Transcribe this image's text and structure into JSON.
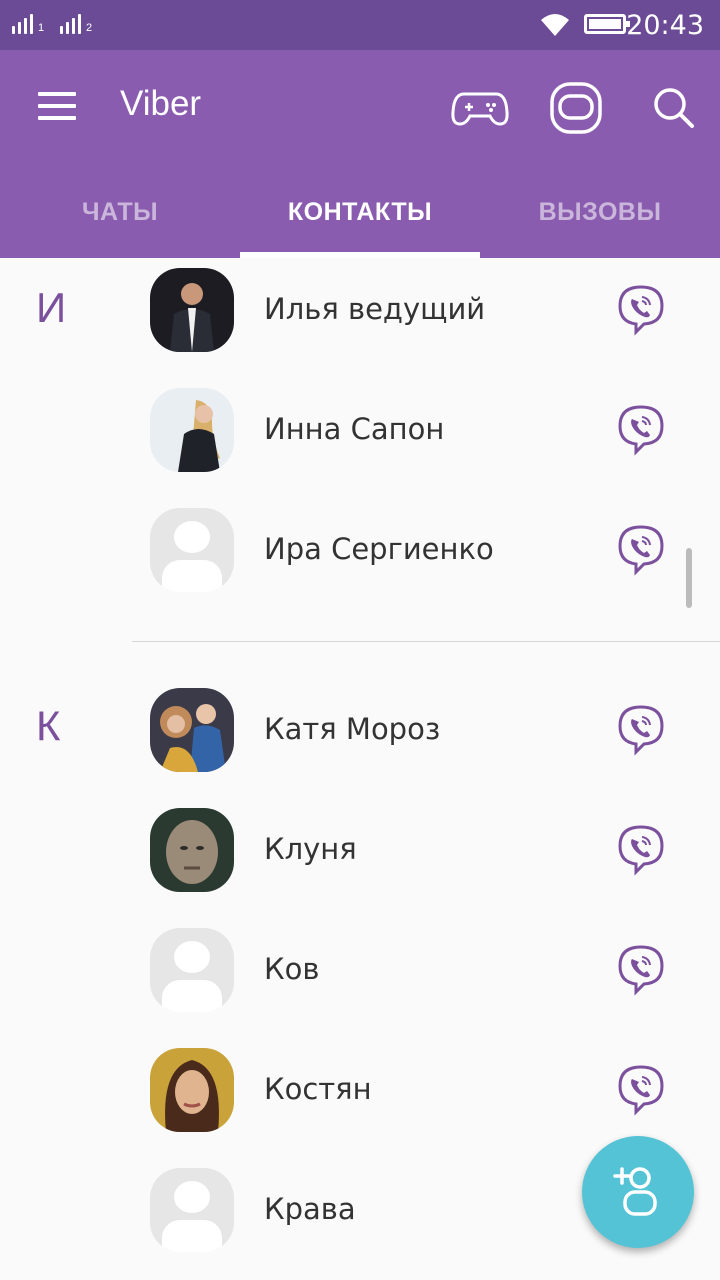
{
  "status_bar": {
    "sim1": "1",
    "sim2": "2",
    "time": "20:43"
  },
  "header": {
    "title": "Viber",
    "icons": [
      "menu-icon",
      "games-icon",
      "sticker-market-icon",
      "search-icon"
    ]
  },
  "tabs": [
    {
      "label": "ЧАТЫ",
      "active": false
    },
    {
      "label": "КОНТАКТЫ",
      "active": true
    },
    {
      "label": "ВЫЗОВЫ",
      "active": false
    }
  ],
  "sections": [
    {
      "letter": "И",
      "contacts": [
        {
          "name": "Илья ведущий",
          "avatar": "photo"
        },
        {
          "name": "Инна Сапон",
          "avatar": "photo"
        },
        {
          "name": "Ира Сергиенко",
          "avatar": "placeholder"
        }
      ]
    },
    {
      "letter": "К",
      "contacts": [
        {
          "name": "Катя Мороз",
          "avatar": "photo"
        },
        {
          "name": "Клуня",
          "avatar": "photo"
        },
        {
          "name": "Ков",
          "avatar": "placeholder"
        },
        {
          "name": "Костян",
          "avatar": "photo"
        },
        {
          "name": "Крава",
          "avatar": "placeholder"
        }
      ]
    }
  ],
  "colors": {
    "accent": "#8a5cb0",
    "status_bar": "#6b4a96",
    "fab": "#55c3d6"
  },
  "fab_icon": "add-contact-icon"
}
